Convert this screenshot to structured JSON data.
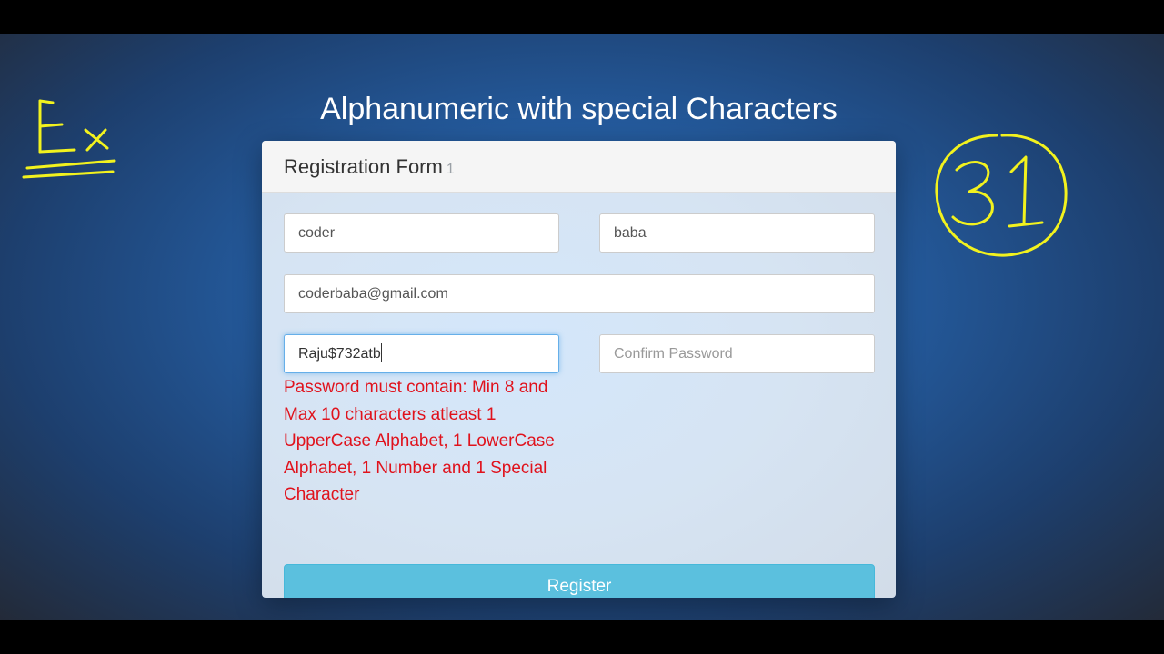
{
  "page": {
    "title": "Alphanumeric with special Characters"
  },
  "annotations": {
    "left_mark": "Ex",
    "right_mark": "31",
    "ink_color": "#f2f21e"
  },
  "form": {
    "heading": "Registration Form",
    "heading_badge": "1",
    "first_name": {
      "value": "coder"
    },
    "last_name": {
      "value": "baba"
    },
    "email": {
      "value": "coderbaba@gmail.com"
    },
    "password": {
      "value": "Raju$732atb"
    },
    "confirm_password": {
      "value": "",
      "placeholder": "Confirm Password"
    },
    "password_error": "Password must contain: Min 8 and Max 10 characters atleast 1 UpperCase Alphabet, 1 LowerCase Alphabet, 1 Number and 1 Special Character",
    "register_label": "Register"
  },
  "colors": {
    "error": "#e0121c",
    "button": "#5bc0de",
    "focus": "#66afe9"
  }
}
